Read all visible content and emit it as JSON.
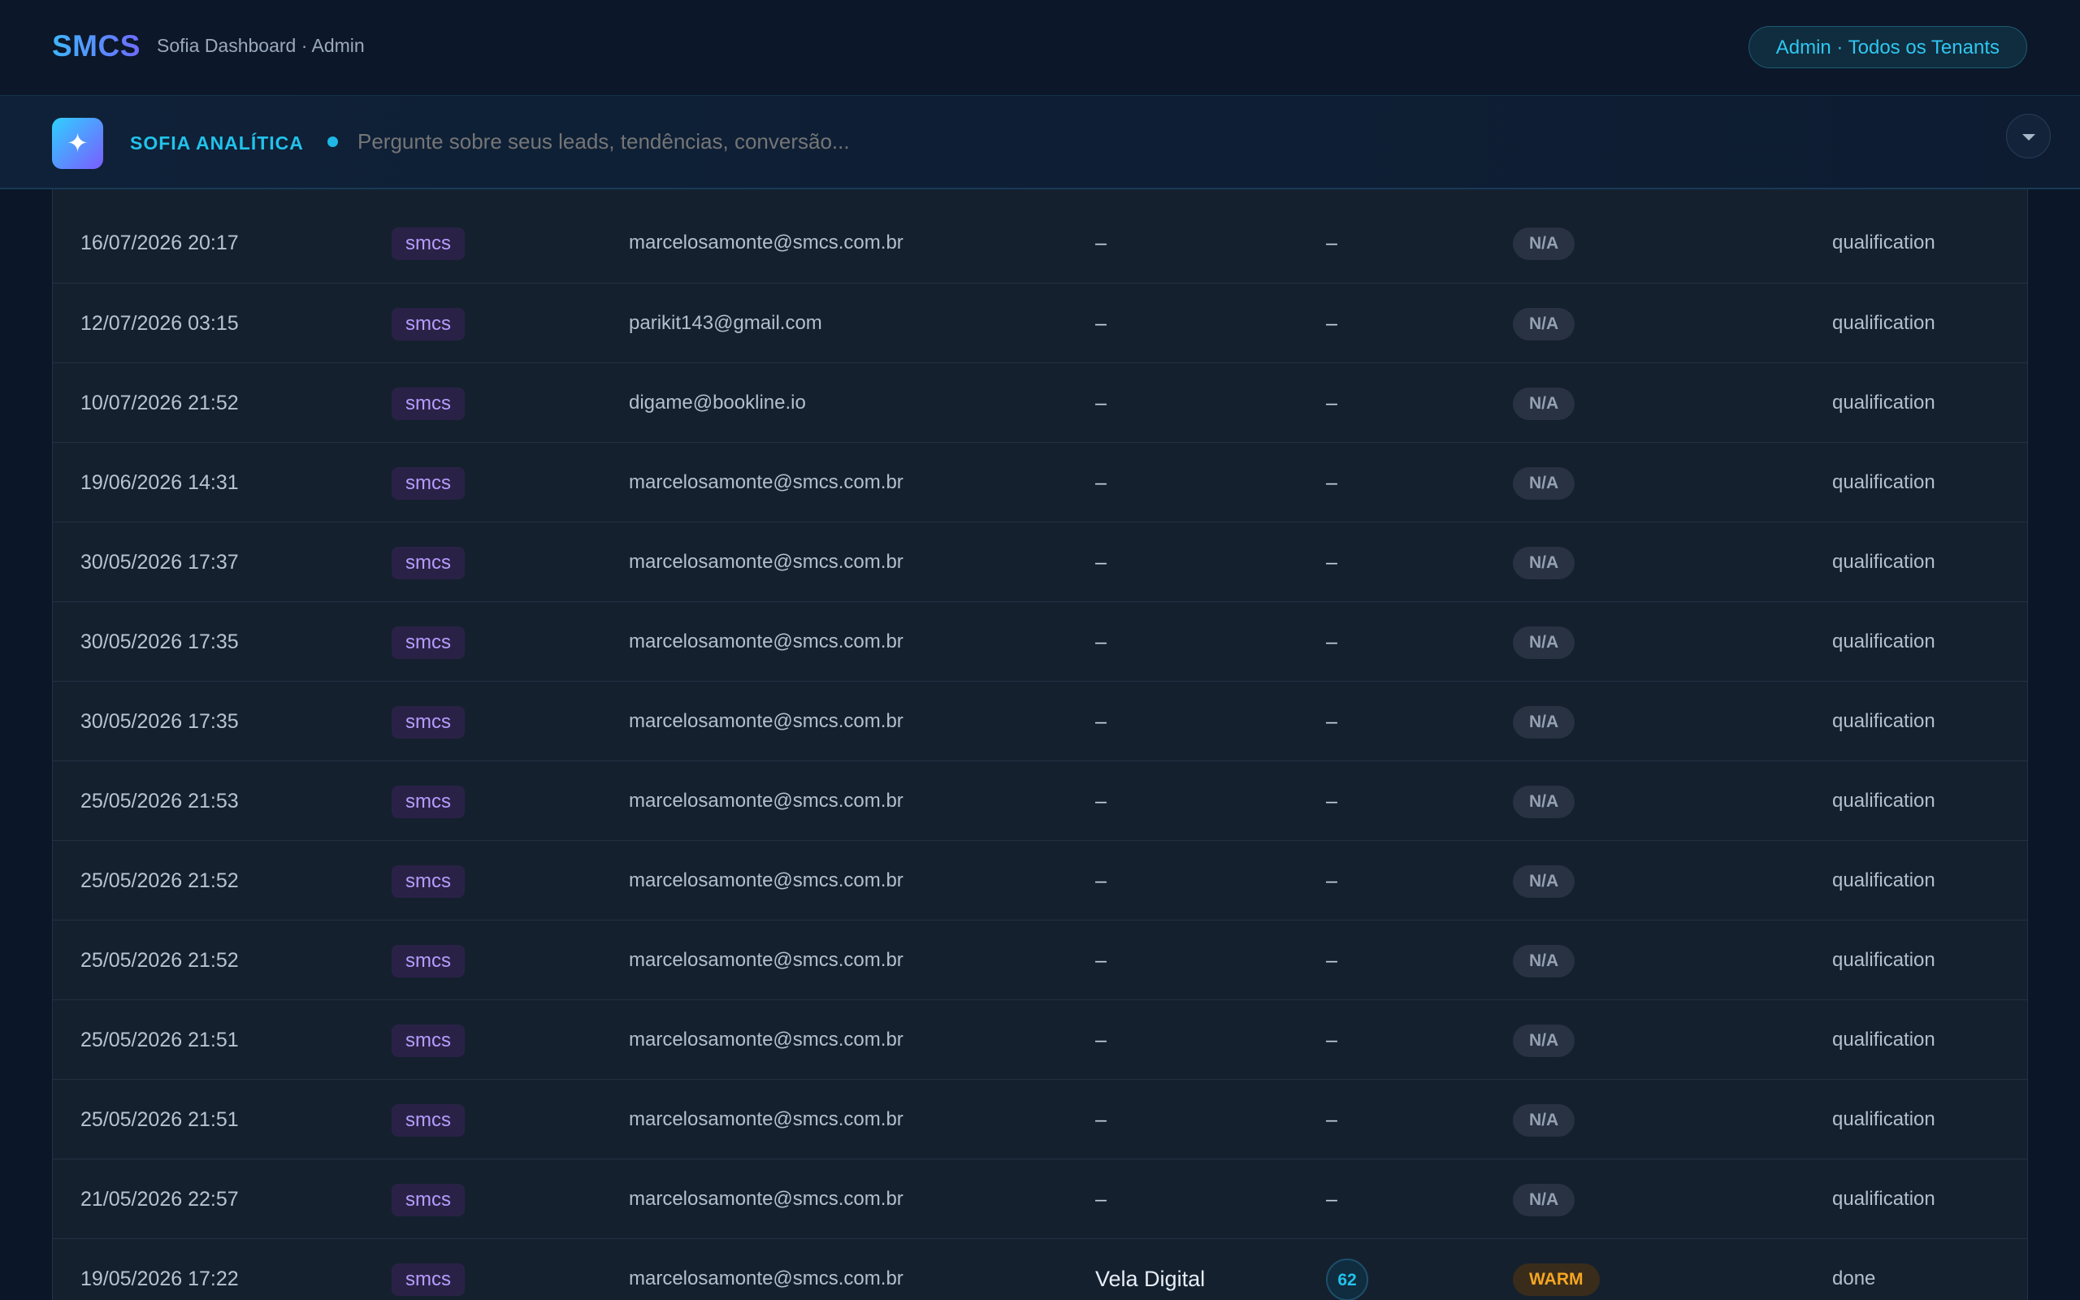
{
  "header": {
    "logo": "SMCS",
    "subtitle": "Sofia Dashboard · Admin",
    "scope_button": "Admin · Todos os Tenants"
  },
  "sofia_bar": {
    "title": "SOFIA ANALÍTICA",
    "icon": "sparkle-icon",
    "placeholder": "Pergunte sobre seus leads, tendências, conversão..."
  },
  "colors": {
    "accent": "#22c2ea",
    "tenant_badge": "#b69cff",
    "warm": "#f5a623"
  },
  "rows": [
    {
      "date": "16/07/2026 20:17",
      "tenant": "smcs",
      "email": "marcelosamonte@smcs.com.br",
      "company": "–",
      "score": "–",
      "temp": "N/A",
      "stage": "qualification"
    },
    {
      "date": "12/07/2026 03:15",
      "tenant": "smcs",
      "email": "parikit143@gmail.com",
      "company": "–",
      "score": "–",
      "temp": "N/A",
      "stage": "qualification"
    },
    {
      "date": "10/07/2026 21:52",
      "tenant": "smcs",
      "email": "digame@bookline.io",
      "company": "–",
      "score": "–",
      "temp": "N/A",
      "stage": "qualification"
    },
    {
      "date": "19/06/2026 14:31",
      "tenant": "smcs",
      "email": "marcelosamonte@smcs.com.br",
      "company": "–",
      "score": "–",
      "temp": "N/A",
      "stage": "qualification"
    },
    {
      "date": "30/05/2026 17:37",
      "tenant": "smcs",
      "email": "marcelosamonte@smcs.com.br",
      "company": "–",
      "score": "–",
      "temp": "N/A",
      "stage": "qualification"
    },
    {
      "date": "30/05/2026 17:35",
      "tenant": "smcs",
      "email": "marcelosamonte@smcs.com.br",
      "company": "–",
      "score": "–",
      "temp": "N/A",
      "stage": "qualification"
    },
    {
      "date": "30/05/2026 17:35",
      "tenant": "smcs",
      "email": "marcelosamonte@smcs.com.br",
      "company": "–",
      "score": "–",
      "temp": "N/A",
      "stage": "qualification"
    },
    {
      "date": "25/05/2026 21:53",
      "tenant": "smcs",
      "email": "marcelosamonte@smcs.com.br",
      "company": "–",
      "score": "–",
      "temp": "N/A",
      "stage": "qualification"
    },
    {
      "date": "25/05/2026 21:52",
      "tenant": "smcs",
      "email": "marcelosamonte@smcs.com.br",
      "company": "–",
      "score": "–",
      "temp": "N/A",
      "stage": "qualification"
    },
    {
      "date": "25/05/2026 21:52",
      "tenant": "smcs",
      "email": "marcelosamonte@smcs.com.br",
      "company": "–",
      "score": "–",
      "temp": "N/A",
      "stage": "qualification"
    },
    {
      "date": "25/05/2026 21:51",
      "tenant": "smcs",
      "email": "marcelosamonte@smcs.com.br",
      "company": "–",
      "score": "–",
      "temp": "N/A",
      "stage": "qualification"
    },
    {
      "date": "25/05/2026 21:51",
      "tenant": "smcs",
      "email": "marcelosamonte@smcs.com.br",
      "company": "–",
      "score": "–",
      "temp": "N/A",
      "stage": "qualification"
    },
    {
      "date": "21/05/2026 22:57",
      "tenant": "smcs",
      "email": "marcelosamonte@smcs.com.br",
      "company": "–",
      "score": "–",
      "temp": "N/A",
      "stage": "qualification"
    },
    {
      "date": "19/05/2026 17:22",
      "tenant": "smcs",
      "email": "marcelosamonte@smcs.com.br",
      "company": "Vela Digital",
      "score": "62",
      "temp": "WARM",
      "stage": "done"
    }
  ]
}
